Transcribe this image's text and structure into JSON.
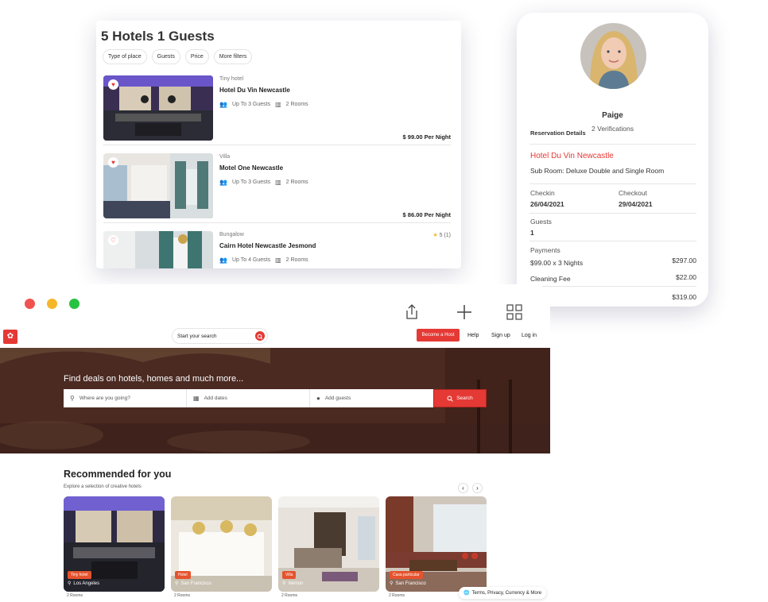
{
  "results": {
    "title": "5 Hotels 1 Guests",
    "filters": [
      "Type of place",
      "Guests",
      "Price",
      "More filters"
    ],
    "hotels": [
      {
        "type": "Tiny hotel",
        "name": "Hotel Du Vin Newcastle",
        "guests": "Up To 3 Guests",
        "rooms": "2 Rooms",
        "price": "$ 99.00 Per Night",
        "rating": ""
      },
      {
        "type": "Villa",
        "name": "Motel One Newcastle",
        "guests": "Up To 3 Guests",
        "rooms": "2 Rooms",
        "price": "$ 86.00 Per Night",
        "rating": ""
      },
      {
        "type": "Bungalow",
        "name": "Cairn Hotel Newcastle Jesmond",
        "guests": "Up To 4 Guests",
        "rooms": "2 Rooms",
        "price": "",
        "rating": "5 (1)"
      }
    ]
  },
  "reservation": {
    "user_name": "Paige",
    "verifications": "2 Verifications",
    "section_title": "Reservation Details",
    "hotel_name": "Hotel Du Vin Newcastle",
    "sub_room": "Sub Room: Deluxe Double and Single Room",
    "checkin_label": "Checkin",
    "checkin_value": "26/04/2021",
    "checkout_label": "Checkout",
    "checkout_value": "29/04/2021",
    "guests_label": "Guests",
    "guests_value": "1",
    "payments_label": "Payments",
    "nights_label": "$99.00 x 3 Nights",
    "nights_value": "$297.00",
    "cleaning_label": "Cleaning Fee",
    "cleaning_value": "$22.00",
    "total_value": "$319.00"
  },
  "browser": {
    "search_placeholder": "Start your search",
    "become_host": "Become a Host",
    "help": "Help",
    "signup": "Sign up",
    "login": "Log in",
    "hero_title": "Find deals on hotels, homes and much more...",
    "where_placeholder": "Where are you going?",
    "dates_placeholder": "Add dates",
    "guests_placeholder": "Add guests",
    "search_button": "Search",
    "rec_title": "Recommended for you",
    "rec_subtitle": "Explore a selection of creative hotels",
    "cards": [
      {
        "badge": "Tiny hotel",
        "location": "Los Angeles",
        "rooms": "2 Rooms"
      },
      {
        "badge": "Hotel",
        "location": "San Francisco",
        "rooms": "2 Rooms"
      },
      {
        "badge": "Villa",
        "location": "Vernon",
        "rooms": "2 Rooms"
      },
      {
        "badge": "Casa particular",
        "location": "San Francisco",
        "rooms": "2 Rooms"
      }
    ],
    "terms": "Terms, Privacy, Currency & More"
  },
  "colors": {
    "accent": "#e53935",
    "dot_red": "#f0524f",
    "dot_yellow": "#f5b728",
    "dot_green": "#27c242"
  }
}
